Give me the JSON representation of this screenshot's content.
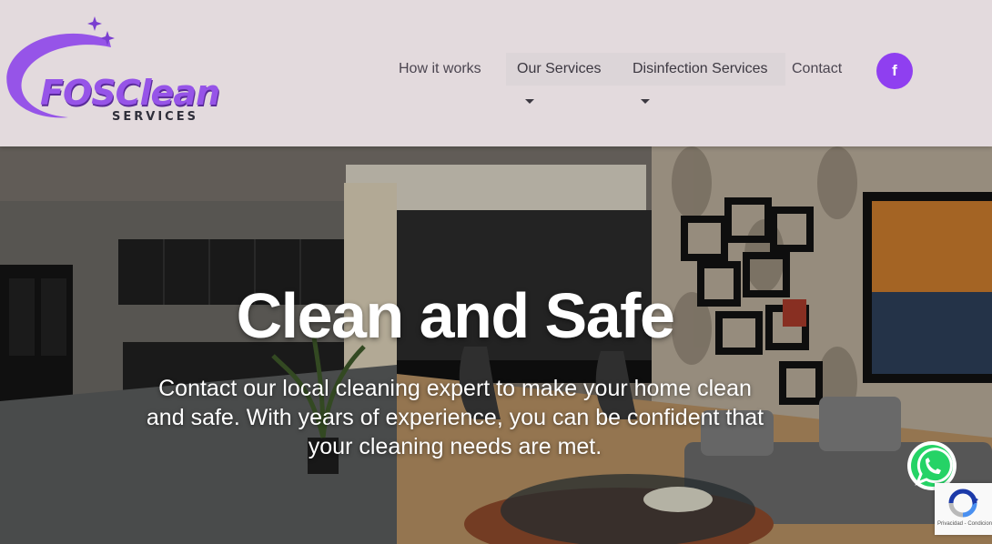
{
  "logo": {
    "name": "FOSClean",
    "tagline": "SERVICES",
    "colors": {
      "primary": "#9654e8",
      "dark": "#2f2f3a"
    }
  },
  "nav": {
    "how_it_works": "How it works",
    "our_services": "Our Services",
    "disinfection_services": "Disinfection Services",
    "contact": "Contact"
  },
  "social": {
    "facebook_glyph": "f",
    "facebook_icon": "facebook-icon",
    "color": "#8f3ff0"
  },
  "hero": {
    "title": "Clean and Safe",
    "text": "Contact our local cleaning expert to make your home clean and safe. With years of experience, you can be confident that your cleaning needs are met."
  },
  "widgets": {
    "whatsapp_icon": "whatsapp-icon",
    "whatsapp_color": "#25d366",
    "recaptcha_icon": "recaptcha-icon",
    "recaptcha_text": "Privacidad - Condiciones"
  }
}
